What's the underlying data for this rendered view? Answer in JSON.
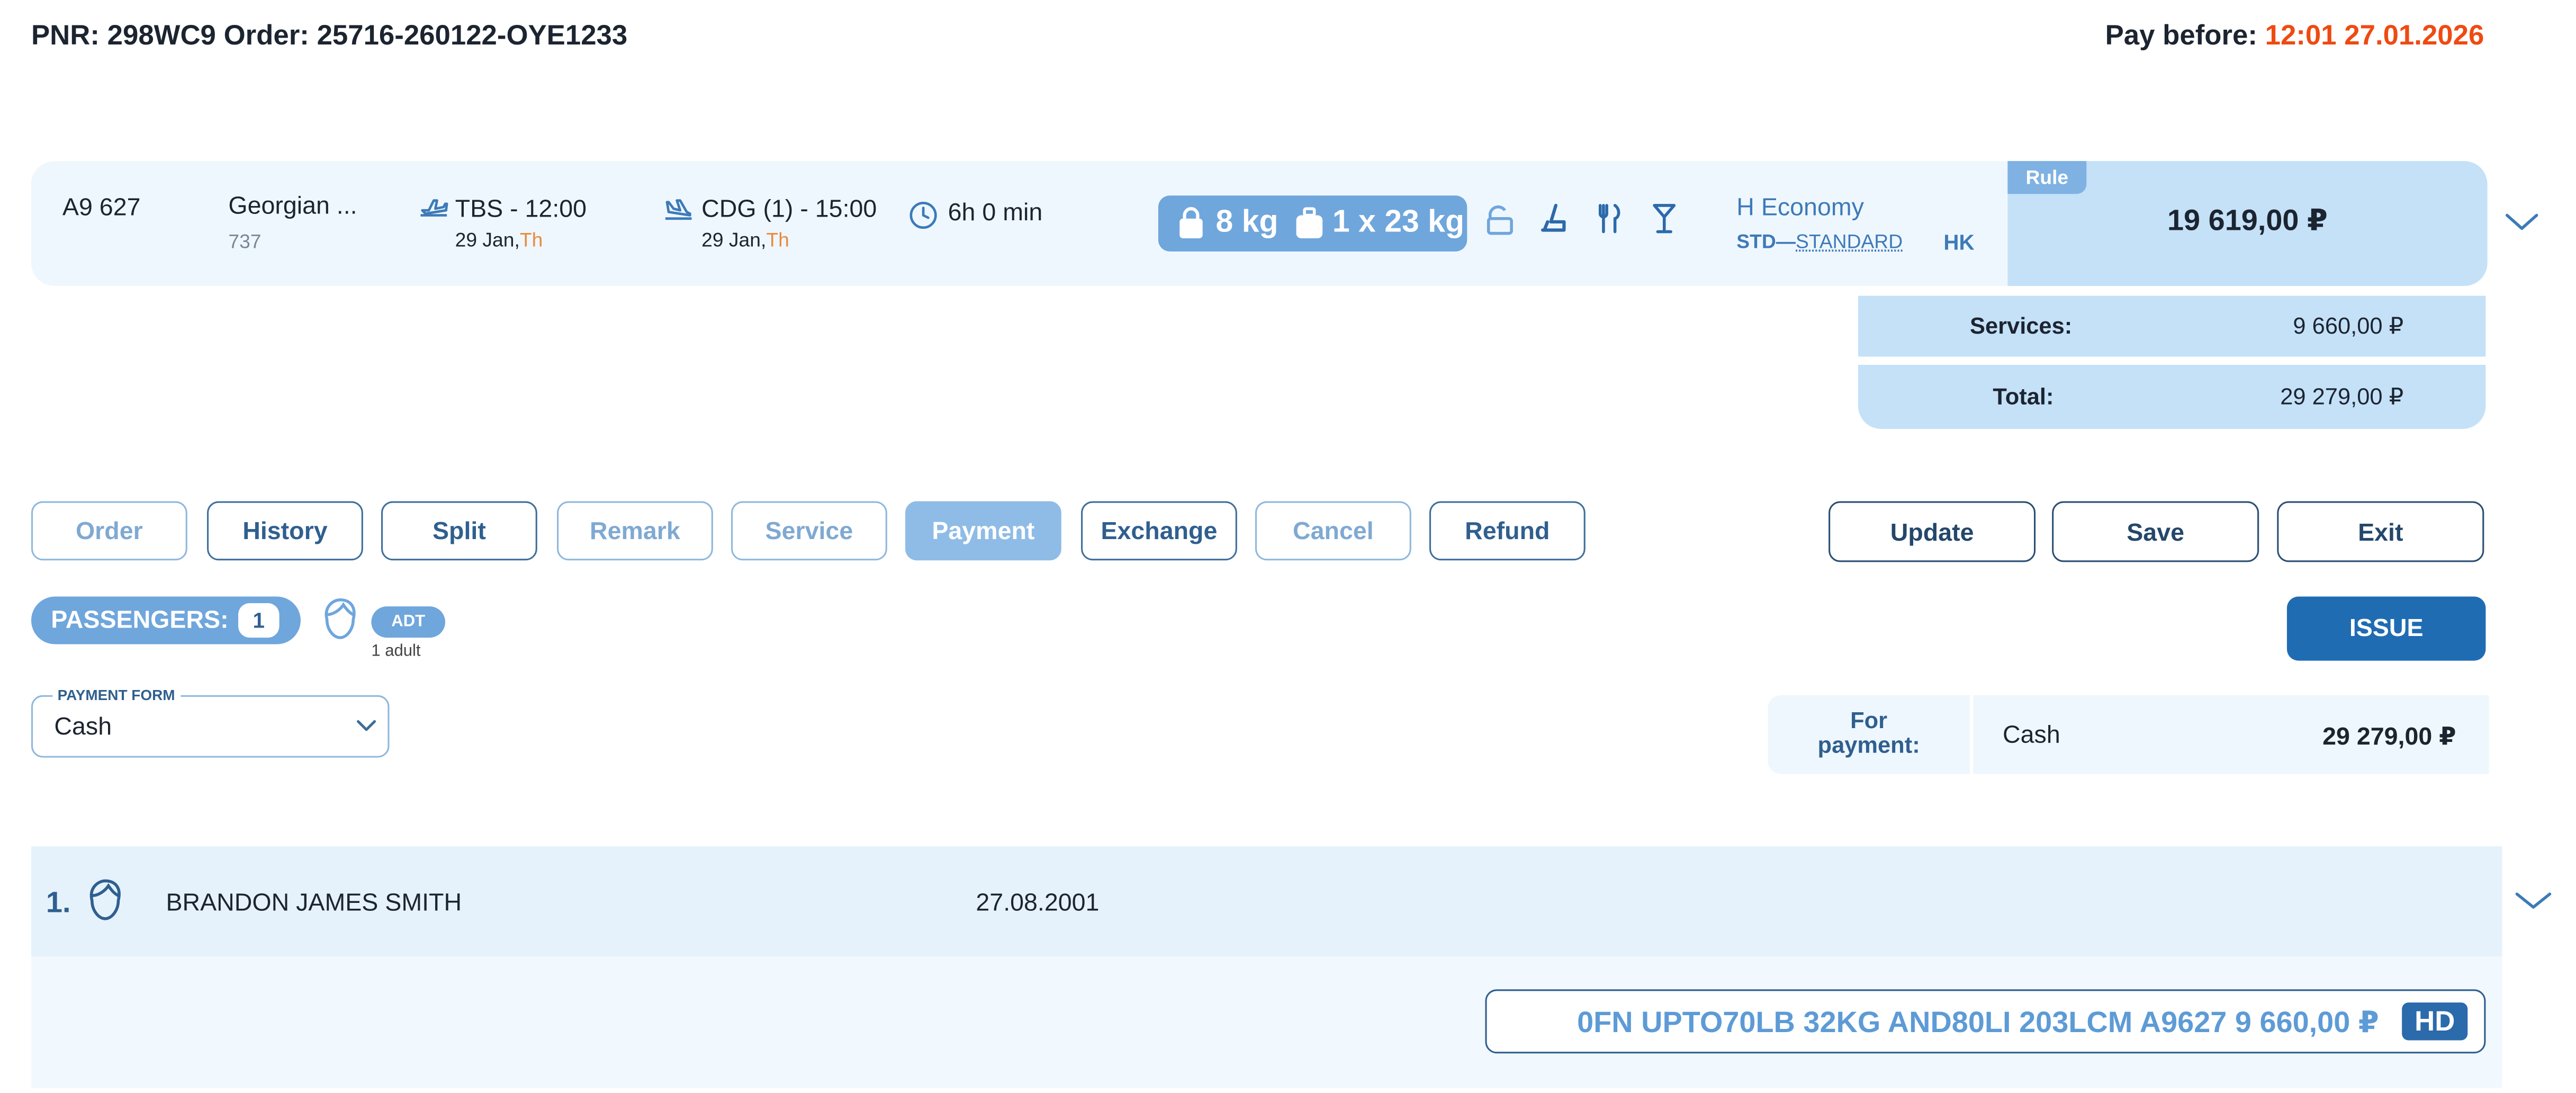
{
  "header": {
    "pnr_label": "PNR:",
    "pnr": "298WC9",
    "order_label": "Order:",
    "order": "25716-260122-OYE1233",
    "pay_before_label": "Pay before:",
    "pay_before_time": "12:01 27.01.2026"
  },
  "flight": {
    "number": "A9 627",
    "airline": "Georgian ...",
    "aircraft": "737",
    "departure": "TBS - 12:00",
    "departure_date": "29 Jan,",
    "departure_dow": "Th",
    "arrival": "CDG (1) - 15:00",
    "arrival_date": "29 Jan,",
    "arrival_dow": "Th",
    "duration": "6h 0 min",
    "hand_baggage": "8 kg",
    "checked_baggage": "1 x 23 kg",
    "cabin": "H Economy",
    "fare_code": "STD",
    "fare_separator": "—",
    "fare_name": "STANDARD",
    "status": "HK",
    "rule_label": "Rule",
    "price": "19 619,00 ₽",
    "icons": [
      "departure-plane-icon",
      "arrival-plane-icon",
      "clock-icon",
      "bag-icon",
      "suitcase-icon",
      "unlock-icon",
      "seat-icon",
      "meal-icon",
      "drink-icon",
      "chevron-down-icon"
    ]
  },
  "totals": {
    "services_label": "Services:",
    "services_value": "9 660,00 ₽",
    "total_label": "Total:",
    "total_value": "29 279,00 ₽"
  },
  "tabs": [
    {
      "label": "Order",
      "state": "muted"
    },
    {
      "label": "History",
      "state": "normal"
    },
    {
      "label": "Split",
      "state": "normal"
    },
    {
      "label": "Remark",
      "state": "muted"
    },
    {
      "label": "Service",
      "state": "muted"
    },
    {
      "label": "Payment",
      "state": "active"
    },
    {
      "label": "Exchange",
      "state": "normal"
    },
    {
      "label": "Cancel",
      "state": "muted"
    },
    {
      "label": "Refund",
      "state": "normal"
    }
  ],
  "actions": {
    "update": "Update",
    "save": "Save",
    "exit": "Exit",
    "issue": "ISSUE"
  },
  "passengers": {
    "label": "PASSENGERS:",
    "count": "1",
    "type_badge": "ADT",
    "type_note": "1 adult"
  },
  "payment": {
    "form_label": "PAYMENT FORM",
    "form_value": "Cash",
    "for_payment_label_1": "For",
    "for_payment_label_2": "payment:",
    "method": "Cash",
    "amount": "29 279,00 ₽"
  },
  "passenger_list": [
    {
      "index": "1.",
      "name": "BRANDON JAMES SMITH",
      "dob": "27.08.2001",
      "service": "0FN UPTO70LB 32KG AND80LI 203LCM A9627 9 660,00 ₽",
      "service_tag": "HD"
    }
  ],
  "colors": {
    "accent": "#6fa6dc",
    "primary": "#1f6cb3",
    "deadline": "#ef4a12",
    "card_bg": "#eff7fe",
    "price_bg": "#c4e1f8"
  }
}
